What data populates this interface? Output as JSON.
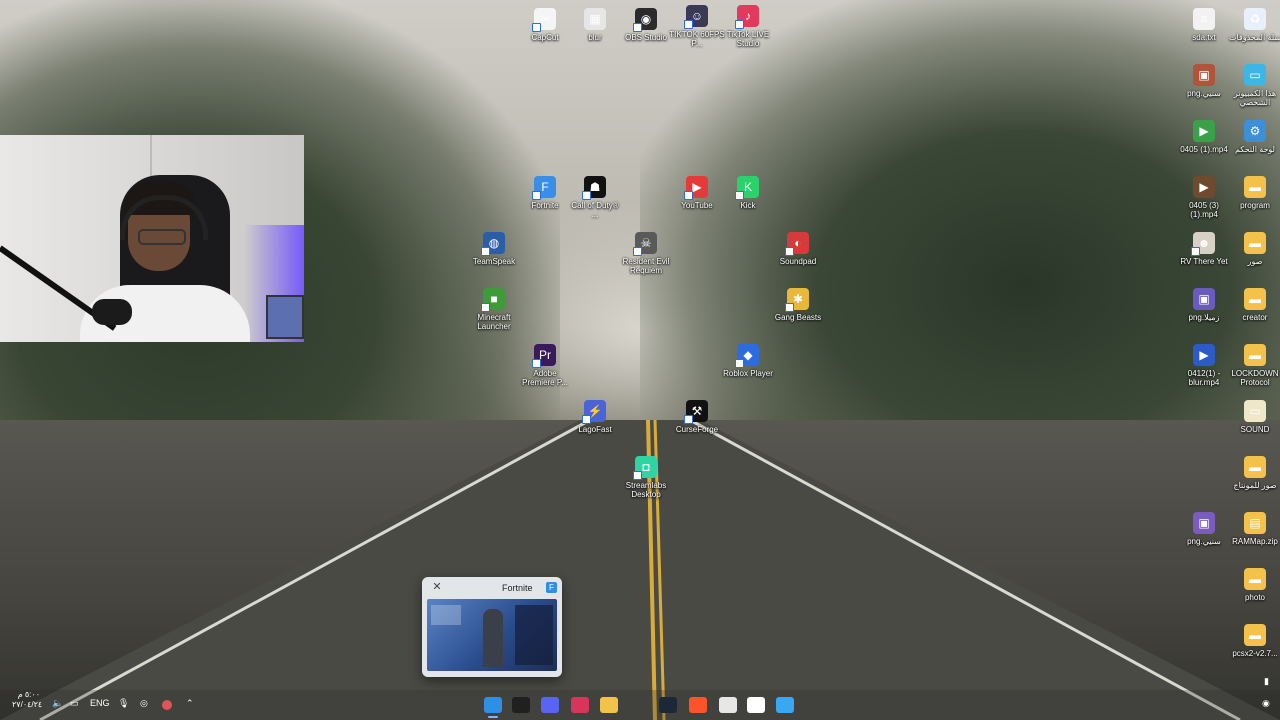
{
  "desktop": {
    "icons": [
      {
        "id": "capcut",
        "label": "CapCut",
        "color": "#f5f5f5",
        "glyph": "✂"
      },
      {
        "id": "blur",
        "label": "blur",
        "color": "#e6e6e6",
        "glyph": "▦"
      },
      {
        "id": "obs",
        "label": "OBS Studio",
        "color": "#2b2b2b",
        "glyph": "◉"
      },
      {
        "id": "tiktok-spam",
        "label": "TIKTOK 60FPS P...",
        "color": "#3a3a55",
        "glyph": "☺"
      },
      {
        "id": "tiktok-live",
        "label": "TikTok LIVE Studio",
        "color": "#e23a5c",
        "glyph": "♪"
      },
      {
        "id": "sda",
        "label": "sda.txt",
        "color": "#f2f2f2",
        "glyph": "≡"
      },
      {
        "id": "recycle",
        "label": "سلة المحذوفات",
        "color": "#e8f0fb",
        "glyph": "♻"
      },
      {
        "id": "my-pc",
        "label": "هذا الكمبيوتر الشخصي",
        "color": "#3bb6e6",
        "glyph": "▭"
      },
      {
        "id": "png1",
        "label": "png.سنيي",
        "color": "#b0553a",
        "glyph": "▣"
      },
      {
        "id": "control",
        "label": "لوحة التحكم",
        "color": "#3c8fd9",
        "glyph": "⚙"
      },
      {
        "id": "mp4-1",
        "label": "0405 (1).mp4",
        "color": "#3aa04a",
        "glyph": "▶"
      },
      {
        "id": "mp4-3",
        "label": "0405 (3) (1).mp4",
        "color": "#6e4a2e",
        "glyph": "▶"
      },
      {
        "id": "program",
        "label": "program",
        "color": "#f2c24a",
        "glyph": "▬"
      },
      {
        "id": "fortnite",
        "label": "Fortnite",
        "color": "#3a8ee6",
        "glyph": "F"
      },
      {
        "id": "cod",
        "label": "Call of Duty® ...",
        "color": "#111",
        "glyph": "☗"
      },
      {
        "id": "youtube",
        "label": "YouTube",
        "color": "#e63a3a",
        "glyph": "▶"
      },
      {
        "id": "kick",
        "label": "Kick",
        "color": "#2bd26b",
        "glyph": "K"
      },
      {
        "id": "rv-there",
        "label": "RV There Yet",
        "color": "#d8d0c5",
        "glyph": "☻"
      },
      {
        "id": "suwar",
        "label": "صور",
        "color": "#f2c24a",
        "glyph": "▬"
      },
      {
        "id": "teamspeak",
        "label": "TeamSpeak",
        "color": "#2c5ea8",
        "glyph": "◍"
      },
      {
        "id": "re-requiem",
        "label": "Resident Evil Requiem",
        "color": "#5a5a5a",
        "glyph": "☠"
      },
      {
        "id": "soundpad",
        "label": "Soundpad",
        "color": "#d63a3a",
        "glyph": "◐"
      },
      {
        "id": "png2",
        "label": "png.زميلا",
        "color": "#6a5bbf",
        "glyph": "▣"
      },
      {
        "id": "creator",
        "label": "creator",
        "color": "#f2c24a",
        "glyph": "▬"
      },
      {
        "id": "minecraft",
        "label": "Minecraft Launcher",
        "color": "#3f9a3a",
        "glyph": "■"
      },
      {
        "id": "gang-beasts",
        "label": "Gang Beasts",
        "color": "#e8b83a",
        "glyph": "✱"
      },
      {
        "id": "premiere",
        "label": "Adobe Premiere P...",
        "color": "#3a1a5a",
        "glyph": "Pr"
      },
      {
        "id": "roblox",
        "label": "Roblox Player",
        "color": "#2c6be0",
        "glyph": "◆"
      },
      {
        "id": "blur-mp4",
        "label": "0412(1) - blur.mp4",
        "color": "#2c5ac7",
        "glyph": "▶"
      },
      {
        "id": "lockdown",
        "label": "LOCKDOWN Protocol",
        "color": "#f2c24a",
        "glyph": "▬"
      },
      {
        "id": "lagofast",
        "label": "LagoFast",
        "color": "#4a63d9",
        "glyph": "⚡"
      },
      {
        "id": "curseforge",
        "label": "CurseForge",
        "color": "#111",
        "glyph": "⚒"
      },
      {
        "id": "sound",
        "label": "SOUND",
        "color": "#f0e6c8",
        "glyph": "▭"
      },
      {
        "id": "streamlabs",
        "label": "Streamlabs Desktop",
        "color": "#2fd5a0",
        "glyph": "◘"
      },
      {
        "id": "montage",
        "label": "صور للمونتاج",
        "color": "#f2c24a",
        "glyph": "▬"
      },
      {
        "id": "png3",
        "label": "png.سنيي",
        "color": "#7a5bbf",
        "glyph": "▣"
      },
      {
        "id": "rammap",
        "label": "RAMMap.zip",
        "color": "#f2c24a",
        "glyph": "▤"
      },
      {
        "id": "photo",
        "label": "photo",
        "color": "#f2c24a",
        "glyph": "▬"
      },
      {
        "id": "pcsx2",
        "label": "pcsx2-v2.7...",
        "color": "#f2c24a",
        "glyph": "▬"
      }
    ]
  },
  "preview": {
    "title": "Fortnite",
    "close_glyph": "✕",
    "app_glyph": "F"
  },
  "taskbar": {
    "items": [
      {
        "id": "fortnite",
        "color": "#2d8fe6",
        "active": true
      },
      {
        "id": "obs",
        "color": "#202020",
        "active": false
      },
      {
        "id": "discord",
        "color": "#5865f2",
        "active": false
      },
      {
        "id": "voicemod",
        "color": "#d8355a",
        "active": false
      },
      {
        "id": "files",
        "color": "#f2c24a",
        "active": false
      },
      {
        "id": "steam",
        "color": "#1b2838",
        "active": false
      },
      {
        "id": "brave",
        "color": "#fb542b",
        "active": false
      },
      {
        "id": "calculator",
        "color": "#e7e7e7",
        "active": false
      },
      {
        "id": "search",
        "color": "#ffffff",
        "active": false
      },
      {
        "id": "start",
        "color": "#3aa7f2",
        "active": false
      }
    ],
    "lang": "ENG",
    "clock_time": "٥:٠٠ م",
    "clock_date": "٢٧/٠٤/٢٤"
  }
}
